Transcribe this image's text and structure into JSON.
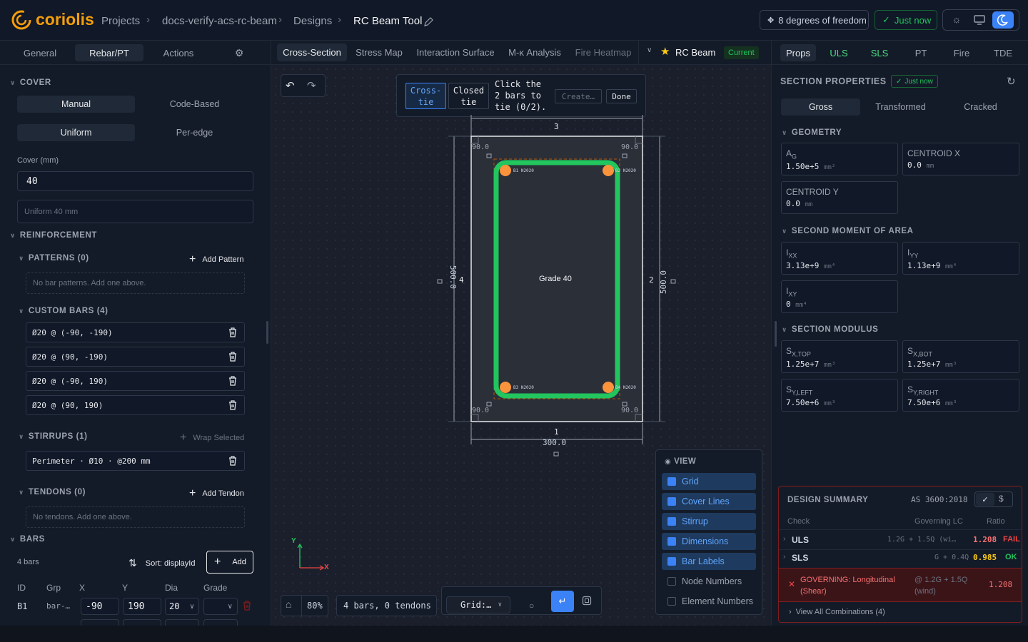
{
  "app": {
    "logo_text": "coriolis",
    "crumbs": [
      "Projects",
      "docs-verify-acs-rc-beam",
      "Designs",
      "RC Beam Tool"
    ],
    "dof": "8 degrees of freedom",
    "saved": "Just now"
  },
  "left": {
    "tabs": [
      "General",
      "Rebar/PT",
      "Actions"
    ],
    "cover": {
      "title": "COVER",
      "mode": [
        "Manual",
        "Code-Based"
      ],
      "edge": [
        "Uniform",
        "Per-edge"
      ],
      "label": "Cover (mm)",
      "value": "40",
      "summary": "Uniform 40 mm"
    },
    "reinf": {
      "title": "REINFORCEMENT"
    },
    "patterns": {
      "title": "PATTERNS (0)",
      "add": "Add Pattern",
      "empty": "No bar patterns. Add one above."
    },
    "custom": {
      "title": "CUSTOM BARS (4)",
      "items": [
        "Ø20 @ (-90, -190)",
        "Ø20 @ (90, -190)",
        "Ø20 @ (-90, 190)",
        "Ø20 @ (90, 190)"
      ]
    },
    "stirrups": {
      "title": "STIRRUPS (1)",
      "add": "Wrap Selected",
      "items": [
        "Perimeter · Ø10 · @200 mm"
      ]
    },
    "tendons": {
      "title": "TENDONS (0)",
      "add": "Add Tendon",
      "empty": "No tendons. Add one above."
    },
    "bars": {
      "title": "BARS",
      "count": "4 bars",
      "sort": "Sort: displayId",
      "add": "Add",
      "cols": [
        "ID",
        "Grp",
        "X",
        "Y",
        "Dia",
        "Grade"
      ],
      "row": {
        "id": "B1",
        "grp": "bar-…",
        "x": "-90",
        "y": "190",
        "dia": "20"
      }
    }
  },
  "mid": {
    "tabs": [
      "Cross-Section",
      "Stress Map",
      "Interaction Surface",
      "M-κ Analysis",
      "Fire Heatmap"
    ],
    "member": "RC Beam",
    "status": "Current",
    "tie": {
      "cross": "Cross-\ntie",
      "closed": "Closed\ntie",
      "msg": "Click the\n2 bars to\ntie (0/2).",
      "create": "Create…",
      "done": "Done"
    },
    "section": {
      "grade": "Grade 40",
      "edges": [
        "3",
        "2",
        "1",
        "4"
      ],
      "width": "300.0",
      "height": "500.0",
      "covers": [
        "90.0",
        "90.0",
        "90.0",
        "90.0"
      ],
      "bars": [
        "B1 N2020",
        "B2 N2020",
        "B3 N2020",
        "B4 N2020"
      ]
    },
    "axis": {
      "x": "X",
      "y": "Y"
    },
    "zoom": "80%",
    "info": "4 bars, 0 tendons",
    "grid": "Grid:…",
    "view": {
      "title": "VIEW",
      "items": [
        {
          "label": "Grid",
          "on": true
        },
        {
          "label": "Cover Lines",
          "on": true
        },
        {
          "label": "Stirrup",
          "on": true
        },
        {
          "label": "Dimensions",
          "on": true
        },
        {
          "label": "Bar Labels",
          "on": true
        },
        {
          "label": "Node Numbers",
          "on": false
        },
        {
          "label": "Element Numbers",
          "on": false
        }
      ]
    }
  },
  "right": {
    "tabs": [
      "Props",
      "ULS",
      "SLS",
      "PT",
      "Fire",
      "TDE"
    ],
    "title": "SECTION PROPERTIES",
    "saved": "Just now",
    "modes": [
      "Gross",
      "Transformed",
      "Cracked"
    ],
    "geometry": {
      "title": "GEOMETRY",
      "cards": [
        {
          "l": "A",
          "s": "G",
          "v": "1.50e+5",
          "u": "mm²"
        },
        {
          "l": "CENTROID X",
          "s": "",
          "v": "0.0",
          "u": "mm"
        },
        {
          "l": "CENTROID Y",
          "s": "",
          "v": "0.0",
          "u": "mm"
        }
      ]
    },
    "moment": {
      "title": "SECOND MOMENT OF AREA",
      "cards": [
        {
          "l": "I",
          "s": "XX",
          "v": "3.13e+9",
          "u": "mm⁴"
        },
        {
          "l": "I",
          "s": "YY",
          "v": "1.13e+9",
          "u": "mm⁴"
        },
        {
          "l": "I",
          "s": "XY",
          "v": "0",
          "u": "mm⁴"
        }
      ]
    },
    "modulus": {
      "title": "SECTION MODULUS",
      "cards": [
        {
          "l": "S",
          "s": "X,TOP",
          "v": "1.25e+7",
          "u": "mm³"
        },
        {
          "l": "S",
          "s": "X,BOT",
          "v": "1.25e+7",
          "u": "mm³"
        },
        {
          "l": "S",
          "s": "Y,LEFT",
          "v": "7.50e+6",
          "u": "mm³"
        },
        {
          "l": "S",
          "s": "Y,RIGHT",
          "v": "7.50e+6",
          "u": "mm³"
        }
      ]
    },
    "summary": {
      "title": "DESIGN SUMMARY",
      "code": "AS 3600:2018",
      "cols": [
        "Check",
        "Governing LC",
        "Ratio"
      ],
      "rows": [
        {
          "check": "ULS",
          "lc": "1.2G + 1.5Q (wi…",
          "ratio": "1.208",
          "status": "FAIL"
        },
        {
          "check": "SLS",
          "lc": "G + 0.4Q",
          "ratio": "0.985",
          "status": "OK"
        }
      ],
      "gov": {
        "text": "GOVERNING: Longitudinal (Shear)",
        "lc": "@ 1.2G + 1.5Q (wind)",
        "ratio": "1.208"
      },
      "all": "View All Combinations (4)"
    }
  }
}
